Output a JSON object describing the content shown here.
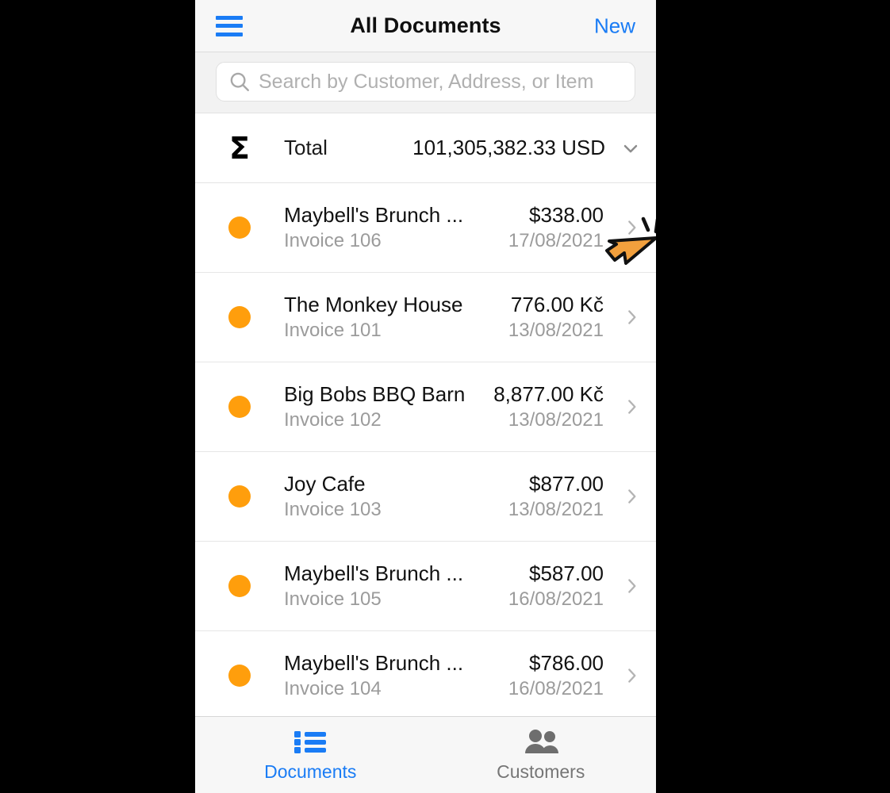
{
  "navbar": {
    "menu_icon": "hamburger-menu-icon",
    "title": "All Documents",
    "new_label": "New"
  },
  "search": {
    "icon": "search-icon",
    "placeholder": "Search by Customer, Address, or Item",
    "value": ""
  },
  "summary": {
    "sigma_symbol": "Σ",
    "label": "Total",
    "value": "101,305,382.33 USD",
    "chevron_icon": "chevron-down-icon"
  },
  "documents": [
    {
      "status_color": "#FF9E0C",
      "customer": "Maybell's Brunch ...",
      "reference": "Invoice 106",
      "amount": "$338.00",
      "date": "17/08/2021"
    },
    {
      "status_color": "#FF9E0C",
      "customer": "The Monkey House",
      "reference": "Invoice 101",
      "amount": "776.00 Kč",
      "date": "13/08/2021"
    },
    {
      "status_color": "#FF9E0C",
      "customer": "Big Bobs BBQ Barn",
      "reference": "Invoice 102",
      "amount": "8,877.00 Kč",
      "date": "13/08/2021"
    },
    {
      "status_color": "#FF9E0C",
      "customer": "Joy Cafe",
      "reference": "Invoice 103",
      "amount": "$877.00",
      "date": "13/08/2021"
    },
    {
      "status_color": "#FF9E0C",
      "customer": "Maybell's Brunch ...",
      "reference": "Invoice 105",
      "amount": "$587.00",
      "date": "16/08/2021"
    },
    {
      "status_color": "#FF9E0C",
      "customer": "Maybell's Brunch ...",
      "reference": "Invoice 104",
      "amount": "$786.00",
      "date": "16/08/2021"
    }
  ],
  "tabbar": {
    "tabs": [
      {
        "icon": "list-icon",
        "label": "Documents",
        "active": true
      },
      {
        "icon": "people-icon",
        "label": "Customers",
        "active": false
      }
    ]
  },
  "cursor": {
    "icon": "mouse-pointer-click-icon",
    "color": "#F2A03D"
  },
  "colors": {
    "accent_blue": "#1a7cf5",
    "status_orange": "#FF9E0C",
    "muted_gray": "#9b9b9b"
  }
}
